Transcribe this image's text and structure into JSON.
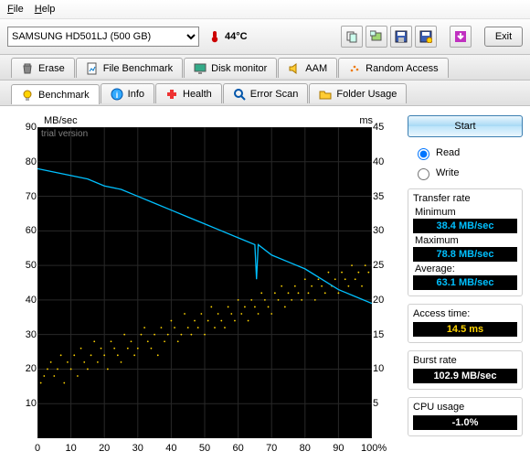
{
  "menu": {
    "file": "File",
    "help": "Help"
  },
  "toolbar": {
    "drive": "SAMSUNG HD501LJ (500 GB)",
    "temp": "44°C",
    "exit": "Exit"
  },
  "tabs_row1": [
    {
      "label": "Erase"
    },
    {
      "label": "File Benchmark"
    },
    {
      "label": "Disk monitor"
    },
    {
      "label": "AAM"
    },
    {
      "label": "Random Access"
    }
  ],
  "tabs_row2": [
    {
      "label": "Benchmark"
    },
    {
      "label": "Info"
    },
    {
      "label": "Health"
    },
    {
      "label": "Error Scan"
    },
    {
      "label": "Folder Usage"
    }
  ],
  "panel": {
    "start": "Start",
    "read": "Read",
    "write": "Write",
    "transfer": {
      "title": "Transfer rate",
      "min_label": "Minimum",
      "min": "38.4 MB/sec",
      "max_label": "Maximum",
      "max": "78.8 MB/sec",
      "avg_label": "Average:",
      "avg": "63.1 MB/sec"
    },
    "access": {
      "title": "Access time:",
      "val": "14.5 ms"
    },
    "burst": {
      "title": "Burst rate",
      "val": "102.9 MB/sec"
    },
    "cpu": {
      "title": "CPU usage",
      "val": "-1.0%"
    }
  },
  "chart_data": {
    "type": "line",
    "title": "trial version",
    "xlabel": "%",
    "y_left_label": "MB/sec",
    "y_right_label": "ms",
    "xlim": [
      0,
      100
    ],
    "y_left_lim": [
      0,
      90
    ],
    "y_right_lim": [
      0,
      45
    ],
    "y_left_ticks": [
      10,
      20,
      30,
      40,
      50,
      60,
      70,
      80,
      90
    ],
    "y_right_ticks": [
      5,
      10,
      15,
      20,
      25,
      30,
      35,
      40,
      45
    ],
    "x_ticks": [
      0,
      10,
      20,
      30,
      40,
      50,
      60,
      70,
      80,
      90,
      100
    ],
    "series": [
      {
        "name": "transfer_rate",
        "color": "#00c0ff",
        "axis": "left",
        "x": [
          0,
          5,
          10,
          15,
          20,
          25,
          30,
          35,
          40,
          45,
          50,
          55,
          60,
          65,
          65.5,
          66,
          70,
          75,
          80,
          85,
          90,
          95,
          100
        ],
        "y": [
          78,
          77,
          76,
          75,
          73,
          72,
          70,
          68,
          66,
          64,
          62,
          60,
          58,
          56,
          46,
          56,
          53,
          51,
          49,
          46,
          43,
          41,
          39
        ]
      },
      {
        "name": "access_time",
        "color": "#ffd400",
        "axis": "right",
        "type": "scatter",
        "x": [
          1,
          2,
          3,
          4,
          5,
          6,
          7,
          8,
          9,
          10,
          11,
          12,
          13,
          14,
          15,
          16,
          17,
          18,
          19,
          20,
          21,
          22,
          23,
          24,
          25,
          26,
          27,
          28,
          29,
          30,
          31,
          32,
          33,
          34,
          35,
          36,
          37,
          38,
          39,
          40,
          41,
          42,
          43,
          44,
          45,
          46,
          47,
          48,
          49,
          50,
          51,
          52,
          53,
          54,
          55,
          56,
          57,
          58,
          59,
          60,
          61,
          62,
          63,
          64,
          65,
          66,
          67,
          68,
          69,
          70,
          71,
          72,
          73,
          74,
          75,
          76,
          77,
          78,
          79,
          80,
          81,
          82,
          83,
          84,
          85,
          86,
          87,
          88,
          89,
          90,
          91,
          92,
          93,
          94,
          95,
          96,
          97,
          98,
          99
        ],
        "y": [
          8,
          9,
          10,
          11,
          9,
          10,
          12,
          8,
          11,
          10,
          12,
          9,
          13,
          11,
          10,
          12,
          14,
          11,
          13,
          12,
          10,
          14,
          13,
          12,
          11,
          15,
          13,
          14,
          12,
          13,
          15,
          16,
          14,
          13,
          15,
          12,
          16,
          14,
          15,
          17,
          16,
          14,
          15,
          18,
          16,
          15,
          17,
          16,
          18,
          15,
          17,
          19,
          16,
          18,
          17,
          16,
          19,
          18,
          17,
          20,
          18,
          19,
          17,
          20,
          19,
          18,
          21,
          20,
          19,
          18,
          21,
          20,
          22,
          19,
          21,
          20,
          22,
          21,
          20,
          23,
          21,
          22,
          20,
          23,
          22,
          21,
          24,
          22,
          23,
          21,
          24,
          23,
          22,
          25,
          23,
          24,
          22,
          25,
          24
        ]
      }
    ]
  }
}
